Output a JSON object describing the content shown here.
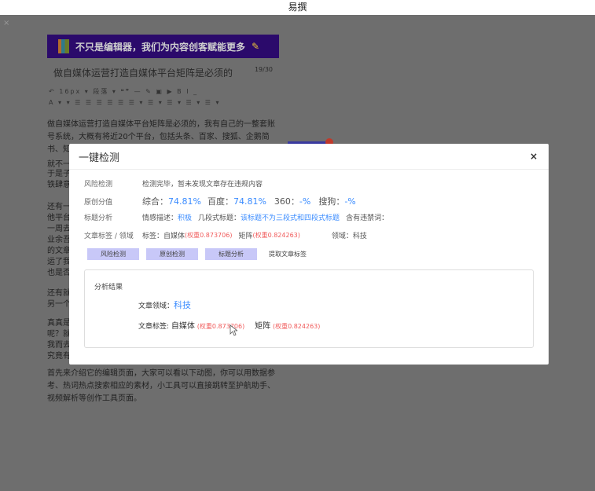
{
  "app": {
    "title": "易撰"
  },
  "editor": {
    "banner": "不只是编辑器，我们为内容创客赋能更多",
    "article_title": "做自媒体运营打造自媒体平台矩阵是必须的",
    "title_count": "19/30",
    "toolbar_row1": "↶   16px  ▾ 段落  ▾ ❝❞ —  ✎  ▣  ▶  B  I  _",
    "toolbar_row2": "A ▾  ▾ ☰ ☰ ☰ ☰ ☰ ☰ ▾ ☰ ▾ ☰ ▾ ☰ ▾ ☰ ▾",
    "para1": "做自媒体运营打造自媒体平台矩阵是必须的，我有自己的一整套账号系统，大概有将近20个平台，包括头条、百家、搜狐、企鹅简书、知乎、大鱼号",
    "fragments": [
      "就不一",
      "于是子",
      "铁肆意",
      "还有一",
      "他平台",
      "一周去",
      "业余吾",
      "的文章",
      "运了我",
      "也是否",
      "还有就",
      "另一个",
      "真真是",
      "呢？就",
      "我而去",
      "究竟有"
    ],
    "para_last": "首先来介绍它的编辑页面，大家可以看以下动图，你可以用数据参考、热词热点搜索相应的素材，小工具可以直接跳转至护航助手、视频解析等创作工具页面。"
  },
  "modal": {
    "title": "一键检测",
    "close": "×",
    "risk": {
      "label": "风险检测",
      "text": "检测完毕，暂未发现文章存在违规内容"
    },
    "original": {
      "label": "原创分值",
      "overall_label": "综合：",
      "overall": "74.81%",
      "baidu_label": "百度：",
      "baidu": "74.81%",
      "s360_label": "360：",
      "s360": "-%",
      "sogou_label": "搜狗：",
      "sogou": "-%"
    },
    "title_analysis": {
      "label": "标题分析",
      "emotion_label": "情感描述：",
      "emotion": "积极",
      "segment_label": "几段式标题：",
      "segment": "该标题不为三段式和四段式标题",
      "banned_label": "含有违禁词："
    },
    "tags": {
      "label": "文章标签 / 领域",
      "tags_label": "标签：",
      "tag1": "自媒体",
      "w1": "(权重0.873706)",
      "tag2": "矩阵",
      "w2": "(权重0.824263)",
      "domain": "领域：科技"
    },
    "buttons": [
      "风险检测",
      "原创检测",
      "标题分析",
      "提取文章标签"
    ],
    "result": {
      "heading": "分析结果",
      "domain_label": "文章领域：",
      "domain": "科技",
      "tags_label": "文章标签:",
      "tag1": "自媒体",
      "w1": "(权重0.873706)",
      "tag2": "矩阵",
      "w2": "(权重0.824263)"
    }
  }
}
